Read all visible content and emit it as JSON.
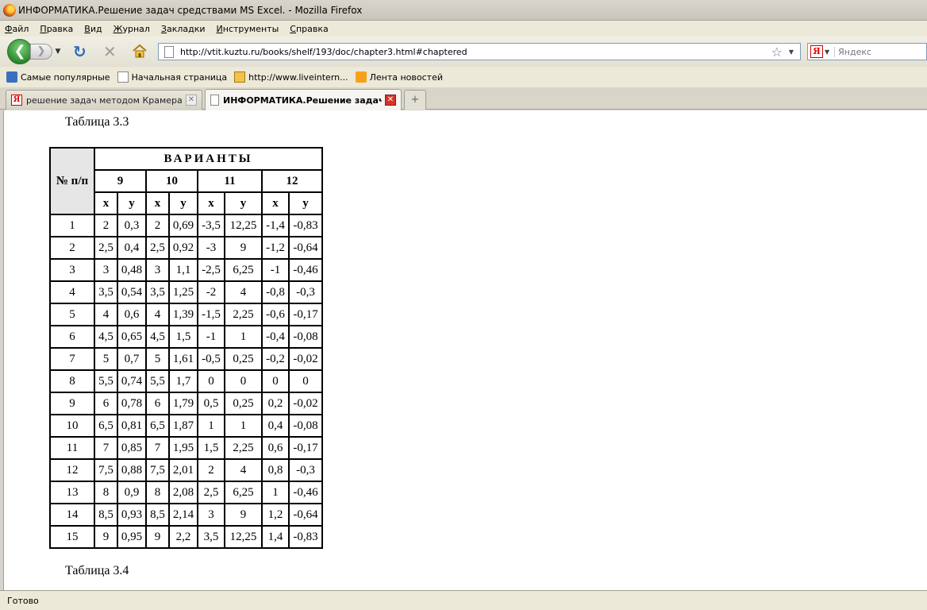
{
  "window": {
    "title": "ИНФОРМАТИКА.Решение задач средствами MS Excel. - Mozilla Firefox"
  },
  "menu": [
    {
      "first": "Ф",
      "rest": "айл"
    },
    {
      "first": "П",
      "rest": "равка"
    },
    {
      "first": "В",
      "rest": "ид"
    },
    {
      "first": "Ж",
      "rest": "урнал"
    },
    {
      "first": "З",
      "rest": "акладки"
    },
    {
      "first": "И",
      "rest": "нструменты"
    },
    {
      "first": "С",
      "rest": "правка"
    }
  ],
  "nav": {
    "url": "http://vtit.kuztu.ru/books/shelf/193/doc/chapter3.html#chaptered",
    "search_placeholder": "Яндекс"
  },
  "bookmarks": [
    {
      "label": "Самые популярные",
      "icon": "popular-icon"
    },
    {
      "label": "Начальная страница",
      "icon": "page-icon"
    },
    {
      "label": "http://www.liveintern...",
      "icon": "liveinternet-icon"
    },
    {
      "label": "Лента новостей",
      "icon": "rss-icon"
    }
  ],
  "tabs": [
    {
      "label": "решение задач методом Крамера в Е..."
    },
    {
      "label": "ИНФОРМАТИКА.Решение задач ..."
    }
  ],
  "content": {
    "caption_top": "Таблица 3.3",
    "caption_bottom": "Таблица 3.4",
    "table": {
      "row_header": "№ п/п",
      "group_header": "ВАРИАНТЫ",
      "variants": [
        "9",
        "10",
        "11",
        "12"
      ],
      "sub_headers": [
        "x",
        "y",
        "x",
        "y",
        "x",
        "y",
        "x",
        "y"
      ],
      "rows": [
        [
          "1",
          "2",
          "0,3",
          "2",
          "0,69",
          "-3,5",
          "12,25",
          "-1,4",
          "-0,83"
        ],
        [
          "2",
          "2,5",
          "0,4",
          "2,5",
          "0,92",
          "-3",
          "9",
          "-1,2",
          "-0,64"
        ],
        [
          "3",
          "3",
          "0,48",
          "3",
          "1,1",
          "-2,5",
          "6,25",
          "-1",
          "-0,46"
        ],
        [
          "4",
          "3,5",
          "0,54",
          "3,5",
          "1,25",
          "-2",
          "4",
          "-0,8",
          "-0,3"
        ],
        [
          "5",
          "4",
          "0,6",
          "4",
          "1,39",
          "-1,5",
          "2,25",
          "-0,6",
          "-0,17"
        ],
        [
          "6",
          "4,5",
          "0,65",
          "4,5",
          "1,5",
          "-1",
          "1",
          "-0,4",
          "-0,08"
        ],
        [
          "7",
          "5",
          "0,7",
          "5",
          "1,61",
          "-0,5",
          "0,25",
          "-0,2",
          "-0,02"
        ],
        [
          "8",
          "5,5",
          "0,74",
          "5,5",
          "1,7",
          "0",
          "0",
          "0",
          "0"
        ],
        [
          "9",
          "6",
          "0,78",
          "6",
          "1,79",
          "0,5",
          "0,25",
          "0,2",
          "-0,02"
        ],
        [
          "10",
          "6,5",
          "0,81",
          "6,5",
          "1,87",
          "1",
          "1",
          "0,4",
          "-0,08"
        ],
        [
          "11",
          "7",
          "0,85",
          "7",
          "1,95",
          "1,5",
          "2,25",
          "0,6",
          "-0,17"
        ],
        [
          "12",
          "7,5",
          "0,88",
          "7,5",
          "2,01",
          "2",
          "4",
          "0,8",
          "-0,3"
        ],
        [
          "13",
          "8",
          "0,9",
          "8",
          "2,08",
          "2,5",
          "6,25",
          "1",
          "-0,46"
        ],
        [
          "14",
          "8,5",
          "0,93",
          "8,5",
          "2,14",
          "3",
          "9",
          "1,2",
          "-0,64"
        ],
        [
          "15",
          "9",
          "0,95",
          "9",
          "2,2",
          "3,5",
          "12,25",
          "1,4",
          "-0,83"
        ]
      ]
    }
  },
  "status": {
    "text": "Готово"
  }
}
